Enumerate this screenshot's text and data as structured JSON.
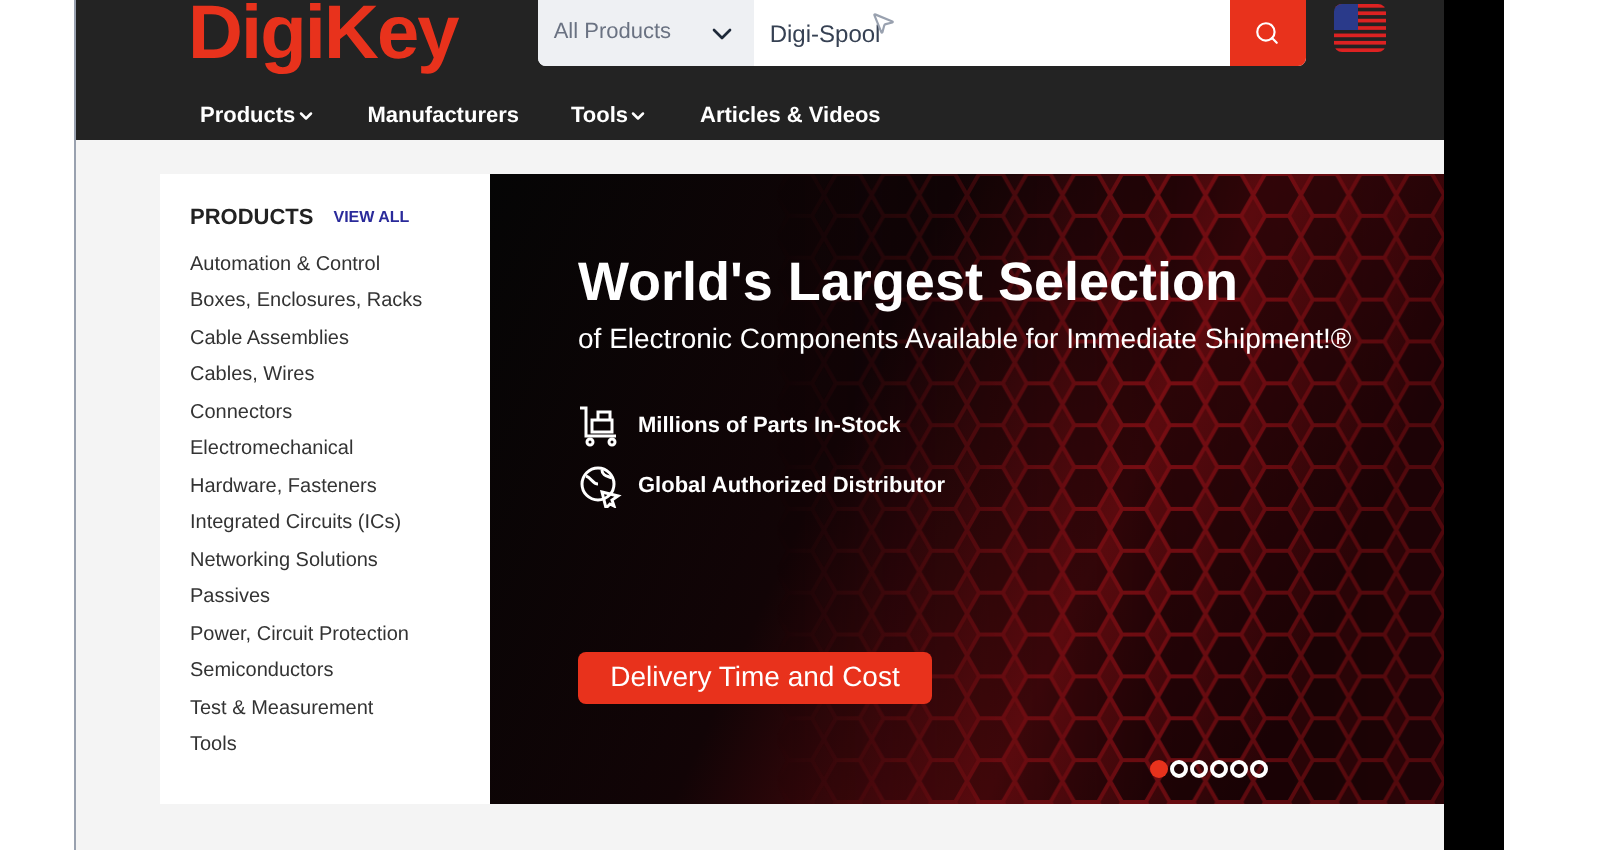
{
  "header": {
    "logo": "DigiKey",
    "search": {
      "category": "All Products",
      "value": "Digi-Spool"
    }
  },
  "nav": [
    {
      "label": "Products",
      "dropdown": true
    },
    {
      "label": "Manufacturers",
      "dropdown": false
    },
    {
      "label": "Tools",
      "dropdown": true
    },
    {
      "label": "Articles & Videos",
      "dropdown": false
    }
  ],
  "products": {
    "title": "PRODUCTS",
    "view_all": "VIEW ALL",
    "items": [
      "Automation & Control",
      "Boxes, Enclosures, Racks",
      "Cable Assemblies",
      "Cables, Wires",
      "Connectors",
      "Electromechanical",
      "Hardware, Fasteners",
      "Integrated Circuits (ICs)",
      "Networking Solutions",
      "Passives",
      "Power, Circuit Protection",
      "Semiconductors",
      "Test & Measurement",
      "Tools"
    ]
  },
  "banner": {
    "title": "World's Largest Selection",
    "subtitle": "of Electronic Components Available for Immediate Shipment!®",
    "features": [
      {
        "kind": "cart",
        "text": "Millions of Parts In-Stock"
      },
      {
        "kind": "globe",
        "text": "Global Authorized Distributor"
      }
    ],
    "button": "Delivery Time and Cost",
    "dots": [
      {
        "selected": true
      },
      {
        "selected": false
      },
      {
        "selected": false
      },
      {
        "selected": false
      },
      {
        "selected": false
      },
      {
        "selected": false
      }
    ]
  }
}
